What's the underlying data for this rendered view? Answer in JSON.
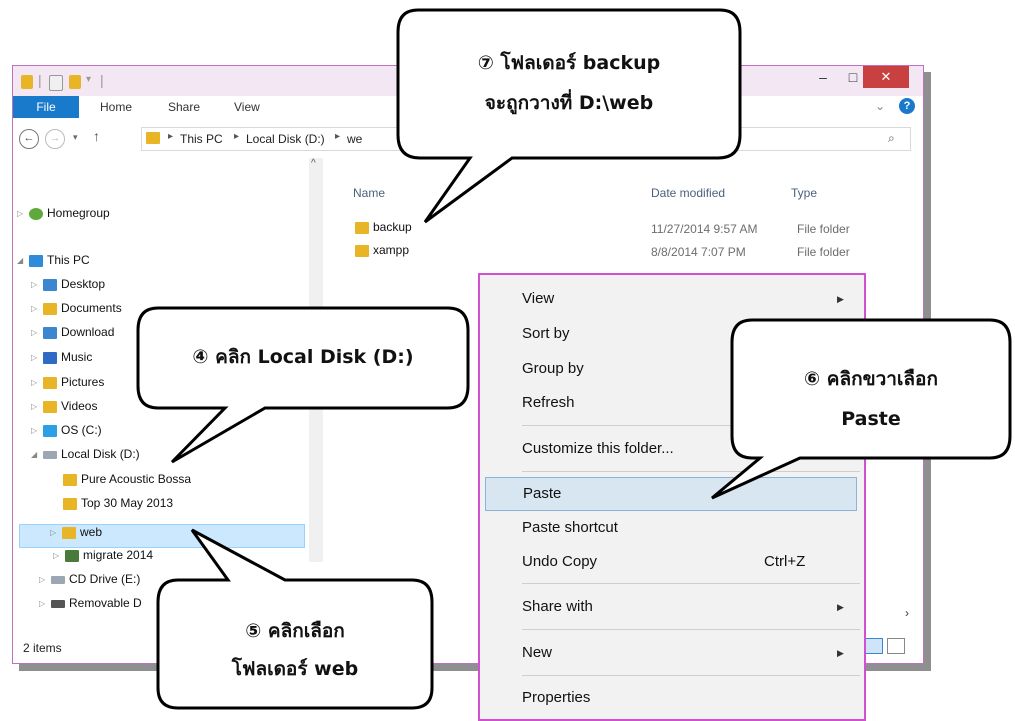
{
  "window": {
    "title_sep": "|",
    "ribbon_tabs": [
      "File",
      "Home",
      "Share",
      "View"
    ],
    "help": "?",
    "minimize": "–",
    "maximize": "□",
    "close": "✕",
    "collapse": "⌄",
    "search_partial": "o"
  },
  "address": {
    "crumbs": [
      "This PC",
      "Local Disk (D:)",
      "we"
    ]
  },
  "nav": {
    "homegroup": "Homegroup",
    "this_pc": "This PC",
    "items": [
      {
        "label": "Desktop"
      },
      {
        "label": "Documents"
      },
      {
        "label": "Download"
      },
      {
        "label": "Music"
      },
      {
        "label": "Pictures"
      },
      {
        "label": "Videos"
      },
      {
        "label": "OS (C:)"
      },
      {
        "label": "Local Disk (D:)"
      },
      {
        "label": "Pure Acoustic Bossa"
      },
      {
        "label": "Top 30 May 2013"
      },
      {
        "label": "web"
      },
      {
        "label": "migrate 2014"
      },
      {
        "label": "CD Drive (E:)"
      },
      {
        "label": "Removable D"
      }
    ]
  },
  "files": {
    "columns": {
      "name": "Name",
      "date": "Date modified",
      "type": "Type"
    },
    "rows": [
      {
        "name": "backup",
        "date": "11/27/2014 9:57 AM",
        "type": "File folder"
      },
      {
        "name": "xampp",
        "date": "8/8/2014 7:07 PM",
        "type": "File folder"
      }
    ]
  },
  "status": {
    "count": "2 items"
  },
  "context_menu": {
    "items": [
      {
        "label": "View",
        "submenu": true
      },
      {
        "label": "Sort by"
      },
      {
        "label": "Group by"
      },
      {
        "label": "Refresh"
      },
      {
        "label": "Customize this folder..."
      },
      {
        "label": "Paste"
      },
      {
        "label": "Paste shortcut"
      },
      {
        "label": "Undo Copy",
        "shortcut": "Ctrl+Z"
      },
      {
        "label": "Share with",
        "submenu": true
      },
      {
        "label": "New",
        "submenu": true
      },
      {
        "label": "Properties"
      }
    ]
  },
  "callouts": {
    "c7_line1": "⑦ โฟลเดอร์ backup",
    "c7_line2": "จะถูกวางที่ D:\\web",
    "c4": "④ คลิก Local Disk (D:)",
    "c6_line1": "⑥ คลิกขวาเลือก",
    "c6_line2": "Paste",
    "c5_line1": "⑤ คลิกเลือก",
    "c5_line2": "โฟลเดอร์ web"
  },
  "colors": {
    "accent": "#1979ca",
    "menu_border": "#d050d0",
    "selection": "#cce8ff",
    "close": "#c84040"
  }
}
